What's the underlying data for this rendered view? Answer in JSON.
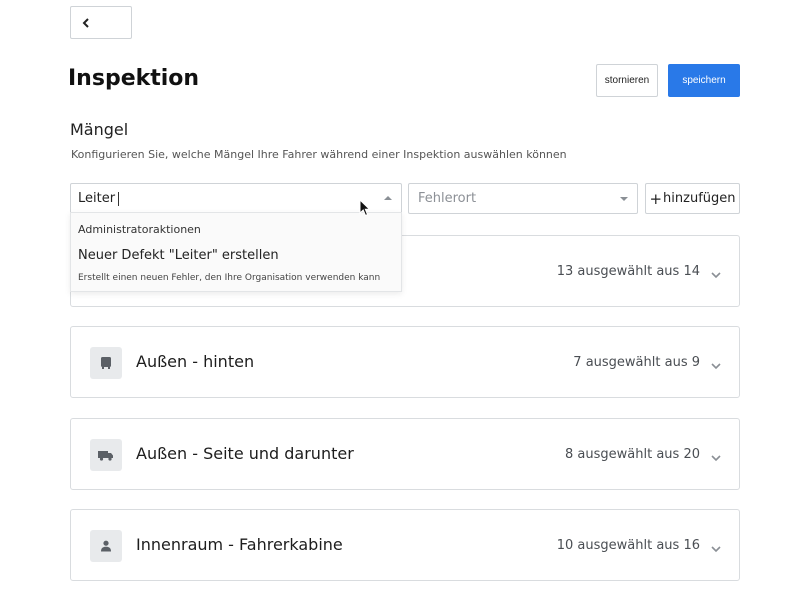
{
  "header": {
    "title": "Inspektion",
    "cancel_label": "stornieren",
    "save_label": "speichern"
  },
  "section": {
    "title": "Mängel",
    "description": "Konfigurieren Sie, welche Mängel Ihre Fahrer während einer Inspektion auswählen können"
  },
  "defect_input": {
    "value": "Leiter"
  },
  "location_select": {
    "placeholder": "Fehlerort"
  },
  "add_button": {
    "label": "hinzufügen"
  },
  "dropdown": {
    "group_label": "Administratoraktionen",
    "option_title": "Neuer Defekt \"Leiter\" erstellen",
    "option_subtitle": "Erstellt einen neuen Fehler, den Ihre Organisation verwenden kann"
  },
  "categories": [
    {
      "label": "",
      "count": "13 ausgewählt aus 14",
      "icon": "hidden-icon"
    },
    {
      "label": "Außen - hinten",
      "count": "7 ausgewählt aus 9",
      "icon": "truck-rear-icon"
    },
    {
      "label": "Außen - Seite und darunter",
      "count": "8 ausgewählt aus 20",
      "icon": "truck-side-icon"
    },
    {
      "label": "Innenraum - Fahrerkabine",
      "count": "10 ausgewählt aus 16",
      "icon": "person-icon"
    }
  ],
  "colors": {
    "primary": "#2979e8",
    "border": "#cfd3d7",
    "icon_bg": "#e8eaec"
  }
}
